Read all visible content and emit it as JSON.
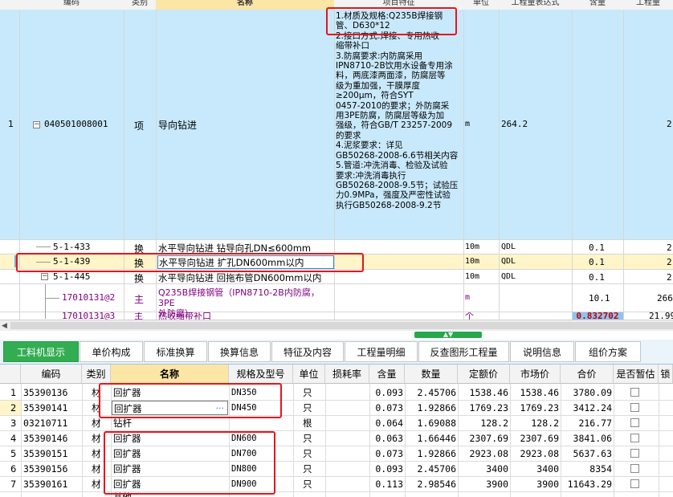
{
  "top_grid": {
    "headers": [
      "编码",
      "类别",
      "名称",
      "项目特征",
      "单位",
      "工程量表达式",
      "含量",
      "工程量"
    ],
    "main_row": {
      "index": "1",
      "code": "040501008001",
      "type": "项",
      "name": "导向钻进",
      "features": [
        "1.材质及规格:Q235B焊接钢",
        "管、D630*12",
        "2.接口方式:焊接、专用热收",
        "缩带补口",
        "3.防腐要求:内防腐采用",
        "IPN8710-2B饮用水设备专用涂",
        "料，两底漆两面漆，防腐层等",
        "级为重加强，干膜厚度",
        "≥200μm，符合SYT",
        "0457-2010的要求；外防腐采",
        "用3PE防腐，防腐层等级为加",
        "强级，符合GB/T 23257-2009",
        "的要求",
        "4.泥浆要求：详见",
        "GB50268-2008-6.6节相关内容",
        "5.管道:冲洗消毒、检验及试验",
        "要求:冲洗消毒执行",
        "GB50268-2008-9.5节；试验压",
        "力0.9MPa，强度及严密性试验",
        "执行GB50268-2008-9.2节"
      ],
      "unit": "m",
      "expr": "264.2",
      "qty": "2"
    },
    "sub_rows": [
      {
        "code": "5-1-433",
        "type": "换",
        "name": "水平导向钻进 钻导向孔DN≤600mm",
        "unit": "10m",
        "expr": "QDL",
        "content": "0.1",
        "qty": "2"
      },
      {
        "code": "5-1-439",
        "type": "换",
        "name": "水平导向钻进 扩孔DN600mm以内",
        "unit": "10m",
        "expr": "QDL",
        "content": "0.1",
        "qty": "2"
      },
      {
        "code": "5-1-445",
        "type": "换",
        "name": "水平导向钻进 回拖布管DN600mm以内",
        "unit": "10m",
        "expr": "QDL",
        "content": "0.1",
        "qty": "2"
      },
      {
        "code": "17010131@2",
        "type": "主",
        "name_lines": [
          "Q235B焊接钢管（IPN8710-2B内防腐，3PE",
          "外防腐）"
        ],
        "unit": "m",
        "content": "10.1",
        "qty": "266"
      },
      {
        "code": "17010131@3",
        "type": "主",
        "name": "热收缩带补口",
        "unit": "个",
        "content": "0.832702",
        "qty": "21.99"
      }
    ]
  },
  "tabs": [
    "工料机显示",
    "单价构成",
    "标准换算",
    "换算信息",
    "特征及内容",
    "工程量明细",
    "反查图形工程量",
    "说明信息",
    "组价方案"
  ],
  "bottom_grid": {
    "headers": [
      "编码",
      "类别",
      "名称",
      "规格及型号",
      "单位",
      "损耗率",
      "含量",
      "数量",
      "定额价",
      "市场价",
      "合价",
      "是否暂估",
      "锁"
    ],
    "rows": [
      {
        "no": "1",
        "code": "35390136",
        "type": "材",
        "name": "回扩器",
        "spec": "DN350",
        "unit": "只",
        "loss": "",
        "content": "0.093",
        "qty": "2.45706",
        "base": "1538.46",
        "market": "1538.46",
        "total": "3780.09"
      },
      {
        "no": "2",
        "code": "35390141",
        "type": "材",
        "name": "回扩器",
        "spec": "DN450",
        "unit": "只",
        "loss": "",
        "content": "0.073",
        "qty": "1.92866",
        "base": "1769.23",
        "market": "1769.23",
        "total": "3412.24"
      },
      {
        "no": "3",
        "code": "03210711",
        "type": "材",
        "name": "钻杆",
        "spec": "",
        "unit": "根",
        "loss": "",
        "content": "0.064",
        "qty": "1.69088",
        "base": "128.2",
        "market": "128.2",
        "total": "216.77"
      },
      {
        "no": "4",
        "code": "35390146",
        "type": "材",
        "name": "回扩器",
        "spec": "DN600",
        "unit": "只",
        "loss": "",
        "content": "0.063",
        "qty": "1.66446",
        "base": "2307.69",
        "market": "2307.69",
        "total": "3841.06"
      },
      {
        "no": "5",
        "code": "35390151",
        "type": "材",
        "name": "回扩器",
        "spec": "DN700",
        "unit": "只",
        "loss": "",
        "content": "0.073",
        "qty": "1.92866",
        "base": "2923.08",
        "market": "2923.08",
        "total": "5637.63"
      },
      {
        "no": "6",
        "code": "35390156",
        "type": "材",
        "name": "回扩器",
        "spec": "DN800",
        "unit": "只",
        "loss": "",
        "content": "0.093",
        "qty": "2.45706",
        "base": "3400",
        "market": "3400",
        "total": "8354"
      },
      {
        "no": "7",
        "code": "35390161",
        "type": "材",
        "name": "回扩器",
        "spec": "DN900",
        "unit": "只",
        "loss": "",
        "content": "0.113",
        "qty": "2.98546",
        "base": "3900",
        "market": "3900",
        "total": "11643.29"
      },
      {
        "no": "8",
        "code": "",
        "type": "",
        "name": "其他",
        "spec": "",
        "unit": "",
        "loss": "",
        "content": "",
        "qty": "",
        "base": "",
        "market": "",
        "total": ""
      }
    ],
    "ellipsis": "···"
  },
  "colors": {
    "accent_green": "#32ad51",
    "highlight_red": "#e8141b",
    "name_header": "#fbe6a5",
    "selected_row": "#c8e9fb"
  }
}
